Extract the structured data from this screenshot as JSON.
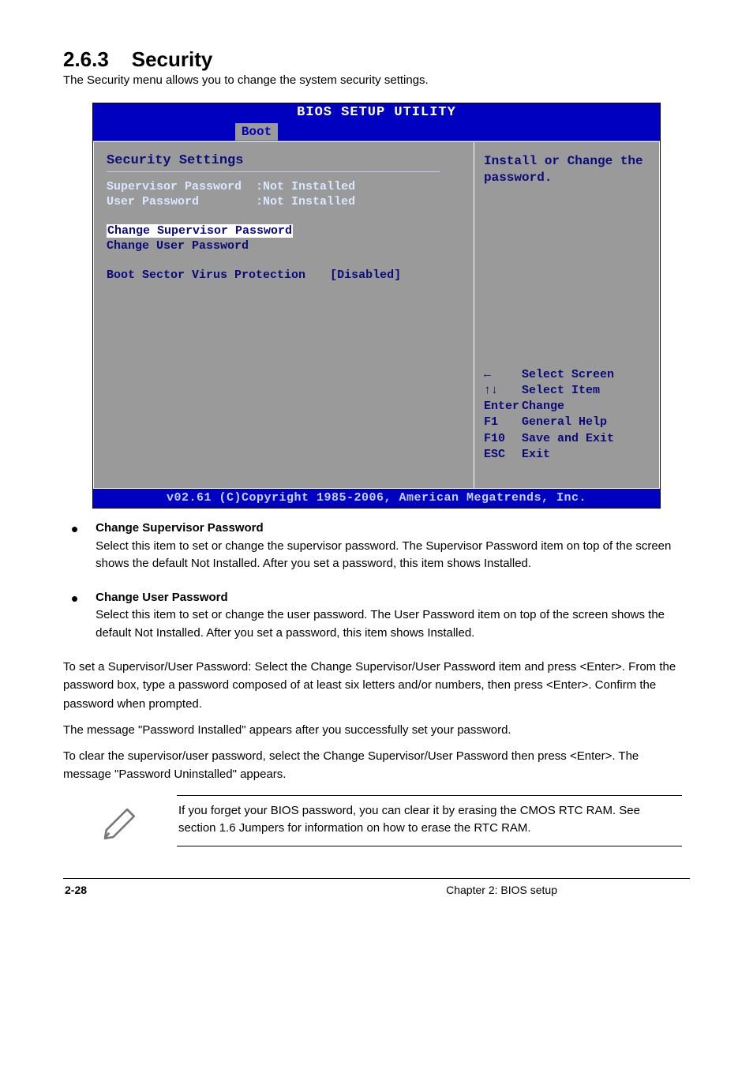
{
  "section": {
    "number": "2.6.3",
    "title": "Security",
    "subtitle": "The Security menu allows you to change the system security settings."
  },
  "bios": {
    "title": "BIOS SETUP UTILITY",
    "activeTab": "Boot",
    "left": {
      "heading": "Security Settings",
      "fields": [
        {
          "label": "Supervisor Password",
          "value": ":Not Installed"
        },
        {
          "label": "User Password",
          "value": ":Not Installed"
        }
      ],
      "items": {
        "changeSupervisor": "Change Supervisor Password",
        "changeUser": "Change User Password",
        "bootSector": {
          "label": "Boot Sector Virus Protection",
          "value": "[Disabled]"
        }
      }
    },
    "right": {
      "help": "Install or Change the password.",
      "keys": [
        {
          "k": "←",
          "d": "Select Screen"
        },
        {
          "k": "↑↓",
          "d": "Select Item"
        },
        {
          "k": "Enter",
          "d": "Change"
        },
        {
          "k": "F1",
          "d": "General Help"
        },
        {
          "k": "F10",
          "d": "Save and Exit"
        },
        {
          "k": "ESC",
          "d": "Exit"
        }
      ]
    },
    "footer": "v02.61 (C)Copyright 1985-2006, American Megatrends, Inc."
  },
  "bullets": [
    {
      "bold": "Change Supervisor Password",
      "rest": "Select this item to set or change the supervisor password. The Supervisor Password item on top of the screen shows the default Not Installed. After you set a password, this item shows Installed."
    },
    {
      "bold": "Change User Password",
      "rest": "Select this item to set or change the user password. The User Password item on top of the screen shows the default Not Installed. After you set a password, this item shows Installed."
    }
  ],
  "paras": {
    "p1": "To set a Supervisor/User Password: Select the Change Supervisor/User Password item and press <Enter>. From the password box, type a password composed of at least six letters and/or numbers, then press <Enter>. Confirm the password when prompted.",
    "p2": "The message \"Password Installed\" appears after you successfully set your password.",
    "p3": "To clear the supervisor/user password, select the Change Supervisor/User Password then press <Enter>. The message \"Password Uninstalled\" appears."
  },
  "note": "If you forget your BIOS password, you can clear it by erasing the CMOS RTC RAM. See section 1.6 Jumpers for information on how to erase the RTC RAM.",
  "footer": {
    "left_bold": "2-28",
    "left_rest": "Chapter 2: BIOS setup",
    "right": ""
  }
}
